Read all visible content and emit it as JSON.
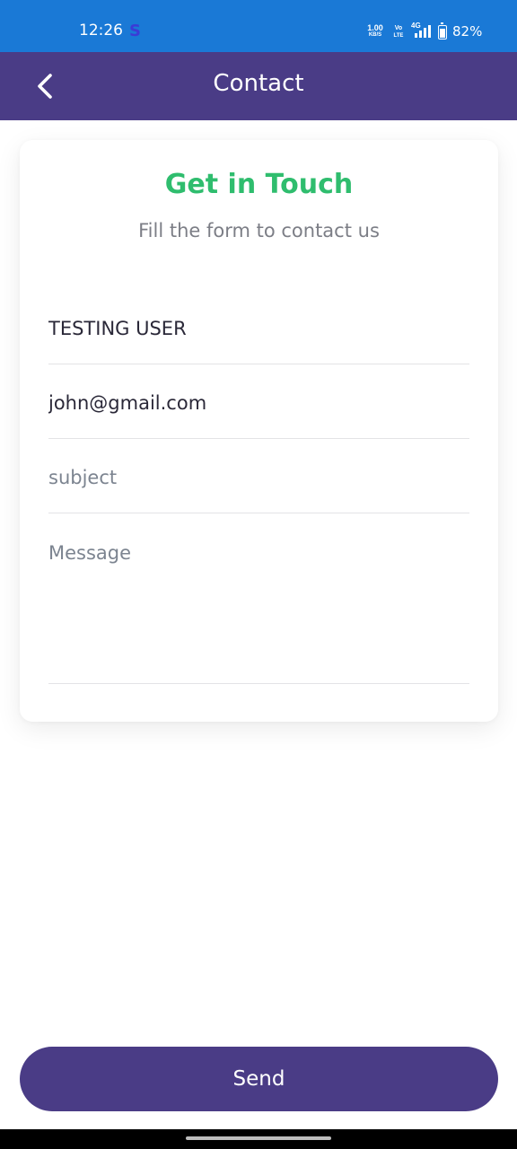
{
  "status_bar": {
    "time": "12:26",
    "app_icon_letter": "S",
    "net_speed_value": "1.00",
    "net_speed_unit": "KB/S",
    "volte_top": "Vo",
    "volte_bottom": "LTE",
    "network_type": "4G",
    "battery": "82%"
  },
  "app_bar": {
    "back_icon": "chevron-left-icon",
    "title": "Contact"
  },
  "card": {
    "title": "Get in Touch",
    "subtitle": "Fill the form to contact us"
  },
  "form": {
    "name_value": "TESTING USER",
    "email_value": "john@gmail.com",
    "subject_value": "",
    "subject_placeholder": "subject",
    "message_value": "",
    "message_placeholder": "Message"
  },
  "send_button_label": "Send",
  "colors": {
    "status_bar": "#1a79d6",
    "primary": "#4a3c86",
    "accent_green": "#2fbd6e",
    "subtitle_gray": "#7c7e86",
    "text_dark": "#2a2838"
  }
}
